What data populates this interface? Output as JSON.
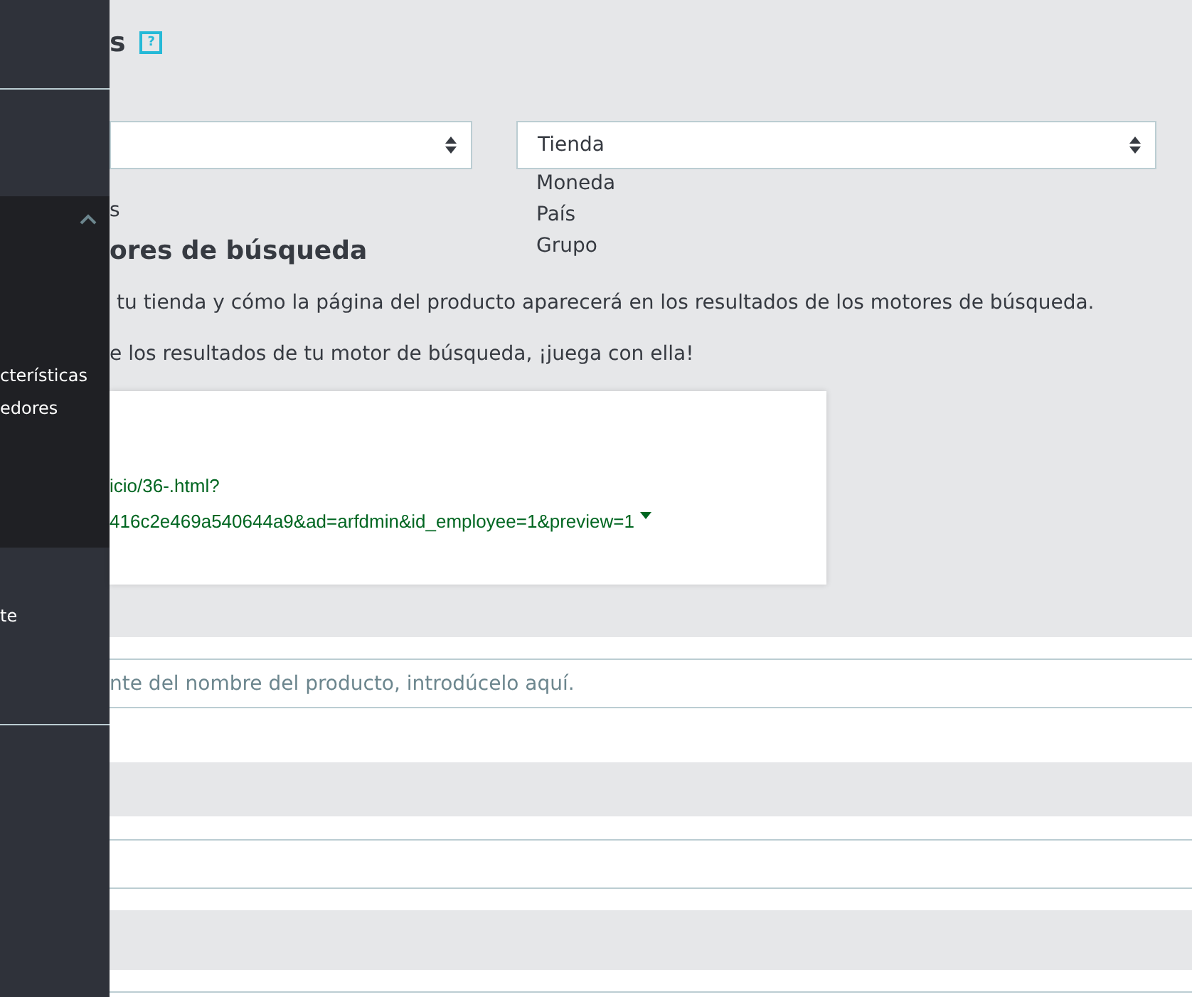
{
  "sidebar": {
    "items": [
      {
        "label": "cterísticas"
      },
      {
        "label": "edores"
      }
    ],
    "lower_items": [
      {
        "label": "te"
      }
    ],
    "expanded": true
  },
  "header": {
    "title": "s",
    "help": "?"
  },
  "selects": [
    {
      "kind": "blank"
    },
    {
      "kind": "filled",
      "value": "Tienda",
      "options": [
        "Moneda",
        "País",
        "Grupo"
      ]
    }
  ],
  "note": "s",
  "seo": {
    "heading": "ores de búsqueda",
    "text1": "tu tienda y cómo la página del producto aparecerá en los resultados de los motores de búsqueda.",
    "text2": "e los resultados de tu motor de búsqueda, ¡juega con ella!",
    "preview": {
      "url_lines": [
        "icio/36-.html?",
        "416c2e469a540644a9&ad=arfdmin&id_employee=1&preview=1"
      ]
    }
  },
  "name_field": {
    "placeholder": "nte del nombre del producto, introdúcelo aquí."
  }
}
